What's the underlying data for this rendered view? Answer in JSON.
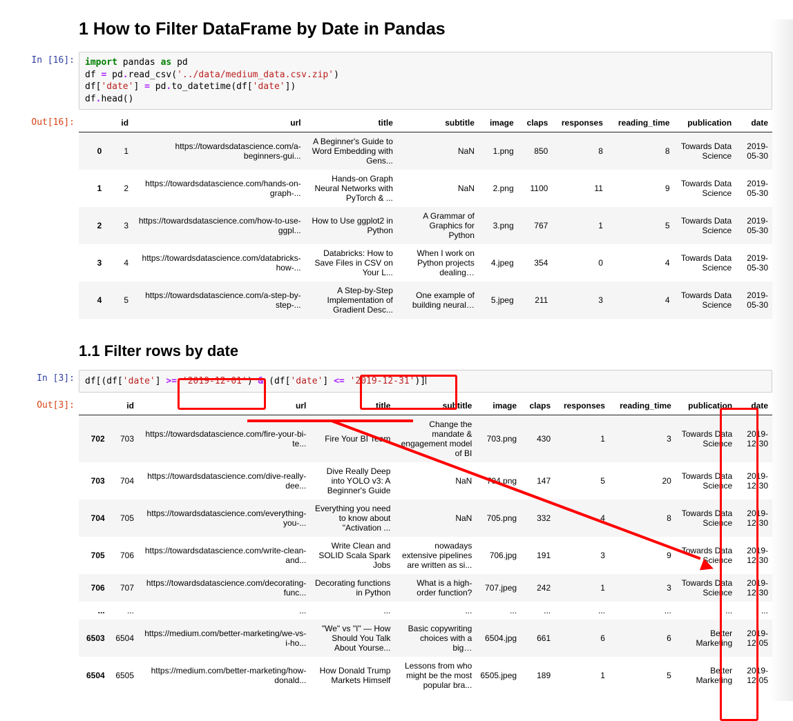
{
  "heading1": "1  How to Filter DataFrame by Date in Pandas",
  "heading2": "1.1  Filter rows by date",
  "cell1": {
    "prompt_in": "In [16]:",
    "prompt_out": "Out[16]:",
    "code_tokens": {
      "t_import": "import",
      "t_sp1": " ",
      "t_pandas": "pandas",
      "t_sp2": " ",
      "t_as": "as",
      "t_sp3": " ",
      "t_pd": "pd",
      "l2a": "df ",
      "t_eq1": "=",
      "l2b": " pd",
      "t_dot1": ".",
      "l2c": "read_csv(",
      "t_str1": "'../data/medium_data.csv.zip'",
      "l2d": ")",
      "l3a": "df[",
      "t_str2": "'date'",
      "l3b": "] ",
      "t_eq2": "=",
      "l3c": " pd",
      "t_dot2": ".",
      "l3d": "to_datetime(df[",
      "t_str3": "'date'",
      "l3e": "])",
      "l4a": "df",
      "t_dot3": ".",
      "l4b": "head()"
    }
  },
  "cell2": {
    "prompt_in": "In [3]:",
    "prompt_out": "Out[3]:",
    "code_tokens": {
      "a": "df[(df[",
      "s1": "'date'",
      "b": "] ",
      "op1": ">=",
      "c": " ",
      "s2": "'2019-12-01'",
      "d": ") ",
      "amp": "&",
      "e": " (df[",
      "s3": "'date'",
      "f": "] ",
      "op2": "<=",
      "g": " ",
      "s4": "'2019-12-31'",
      "h": ")]"
    }
  },
  "table1": {
    "columns": [
      "",
      "id",
      "url",
      "title",
      "subtitle",
      "image",
      "claps",
      "responses",
      "reading_time",
      "publication",
      "date"
    ],
    "rows": [
      {
        "idx": "0",
        "id": "1",
        "url": "https://towardsdatascience.com/a-beginners-gui...",
        "title": "A Beginner's Guide to Word Embedding with Gens...",
        "subtitle": "NaN",
        "image": "1.png",
        "claps": "850",
        "responses": "8",
        "reading_time": "8",
        "publication": "Towards Data Science",
        "date": "2019-05-30"
      },
      {
        "idx": "1",
        "id": "2",
        "url": "https://towardsdatascience.com/hands-on-graph-...",
        "title": "Hands-on Graph Neural Networks with PyTorch & ...",
        "subtitle": "NaN",
        "image": "2.png",
        "claps": "1100",
        "responses": "11",
        "reading_time": "9",
        "publication": "Towards Data Science",
        "date": "2019-05-30"
      },
      {
        "idx": "2",
        "id": "3",
        "url": "https://towardsdatascience.com/how-to-use-ggpl...",
        "title": "How to Use ggplot2 in Python",
        "subtitle": "A Grammar of Graphics for Python",
        "image": "3.png",
        "claps": "767",
        "responses": "1",
        "reading_time": "5",
        "publication": "Towards Data Science",
        "date": "2019-05-30"
      },
      {
        "idx": "3",
        "id": "4",
        "url": "https://towardsdatascience.com/databricks-how-...",
        "title": "Databricks: How to Save Files in CSV on Your L...",
        "subtitle": "When I work on Python projects dealing…",
        "image": "4.jpeg",
        "claps": "354",
        "responses": "0",
        "reading_time": "4",
        "publication": "Towards Data Science",
        "date": "2019-05-30"
      },
      {
        "idx": "4",
        "id": "5",
        "url": "https://towardsdatascience.com/a-step-by-step-...",
        "title": "A Step-by-Step Implementation of Gradient Desc...",
        "subtitle": "One example of building neural…",
        "image": "5.jpeg",
        "claps": "211",
        "responses": "3",
        "reading_time": "4",
        "publication": "Towards Data Science",
        "date": "2019-05-30"
      }
    ]
  },
  "table2": {
    "columns": [
      "",
      "id",
      "url",
      "title",
      "subtitle",
      "image",
      "claps",
      "responses",
      "reading_time",
      "publication",
      "date"
    ],
    "rows": [
      {
        "idx": "702",
        "id": "703",
        "url": "https://towardsdatascience.com/fire-your-bi-te...",
        "title": "Fire Your BI Team",
        "subtitle": "Change the mandate & engagement model of BI",
        "image": "703.png",
        "claps": "430",
        "responses": "1",
        "reading_time": "3",
        "publication": "Towards Data Science",
        "date": "2019-12-30"
      },
      {
        "idx": "703",
        "id": "704",
        "url": "https://towardsdatascience.com/dive-really-dee...",
        "title": "Dive Really Deep into YOLO v3: A Beginner's Guide",
        "subtitle": "NaN",
        "image": "704.png",
        "claps": "147",
        "responses": "5",
        "reading_time": "20",
        "publication": "Towards Data Science",
        "date": "2019-12-30"
      },
      {
        "idx": "704",
        "id": "705",
        "url": "https://towardsdatascience.com/everything-you-...",
        "title": "Everything you need to know about \"Activation ...",
        "subtitle": "NaN",
        "image": "705.png",
        "claps": "332",
        "responses": "4",
        "reading_time": "8",
        "publication": "Towards Data Science",
        "date": "2019-12-30"
      },
      {
        "idx": "705",
        "id": "706",
        "url": "https://towardsdatascience.com/write-clean-and...",
        "title": "Write Clean and SOLID Scala Spark Jobs",
        "subtitle": "nowadays extensive pipelines are written as si...",
        "image": "706.jpg",
        "claps": "191",
        "responses": "3",
        "reading_time": "9",
        "publication": "Towards Data Science",
        "date": "2019-12-30"
      },
      {
        "idx": "706",
        "id": "707",
        "url": "https://towardsdatascience.com/decorating-func...",
        "title": "Decorating functions in Python",
        "subtitle": "What is a high-order function?",
        "image": "707.jpeg",
        "claps": "242",
        "responses": "1",
        "reading_time": "3",
        "publication": "Towards Data Science",
        "date": "2019-12-30"
      },
      {
        "idx": "...",
        "id": "...",
        "url": "...",
        "title": "...",
        "subtitle": "...",
        "image": "...",
        "claps": "...",
        "responses": "...",
        "reading_time": "...",
        "publication": "...",
        "date": "..."
      },
      {
        "idx": "6503",
        "id": "6504",
        "url": "https://medium.com/better-marketing/we-vs-i-ho...",
        "title": "\"We\" vs \"I\" — How Should You Talk About Yourse...",
        "subtitle": "Basic copywriting choices with a big…",
        "image": "6504.jpg",
        "claps": "661",
        "responses": "6",
        "reading_time": "6",
        "publication": "Better Marketing",
        "date": "2019-12-05"
      },
      {
        "idx": "6504",
        "id": "6505",
        "url": "https://medium.com/better-marketing/how-donald...",
        "title": "How Donald Trump Markets Himself",
        "subtitle": "Lessons from who might be the most popular bra...",
        "image": "6505.jpeg",
        "claps": "189",
        "responses": "1",
        "reading_time": "5",
        "publication": "Better Marketing",
        "date": "2019-12-05"
      }
    ]
  }
}
